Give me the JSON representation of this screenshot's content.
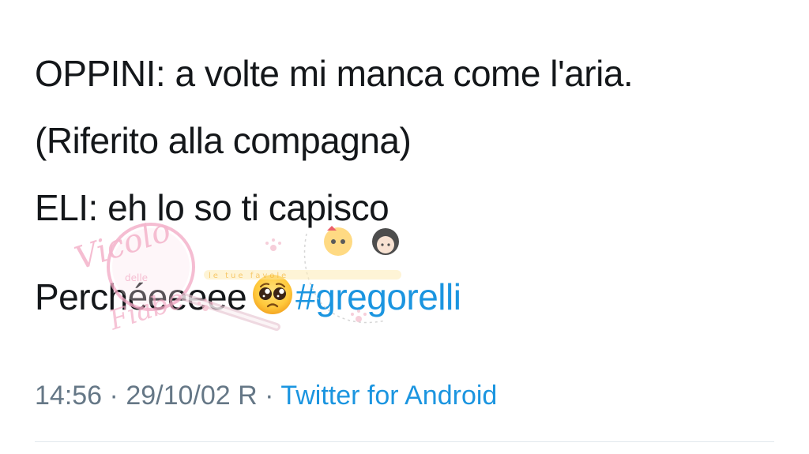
{
  "tweet": {
    "lines": [
      "OPPINI: a volte mi manca come l'aria.",
      "(Riferito alla compagna)",
      "ELI: eh lo so ti capisco",
      "Perchéeeeee"
    ],
    "emoji": "pleading-face-emoji",
    "hashtag": "#gregorelli",
    "time": "14:56",
    "date": "29/10/02 R",
    "separator": "·",
    "source": "Twitter for Android"
  },
  "watermark": {
    "text": "Vicolo delle Fiabe",
    "band_text": "le tue favole"
  },
  "colors": {
    "text": "#14171a",
    "link": "#1b95e0",
    "meta": "#657786",
    "divider": "#e1e8ed",
    "watermark_pink": "#f2a9c4"
  }
}
